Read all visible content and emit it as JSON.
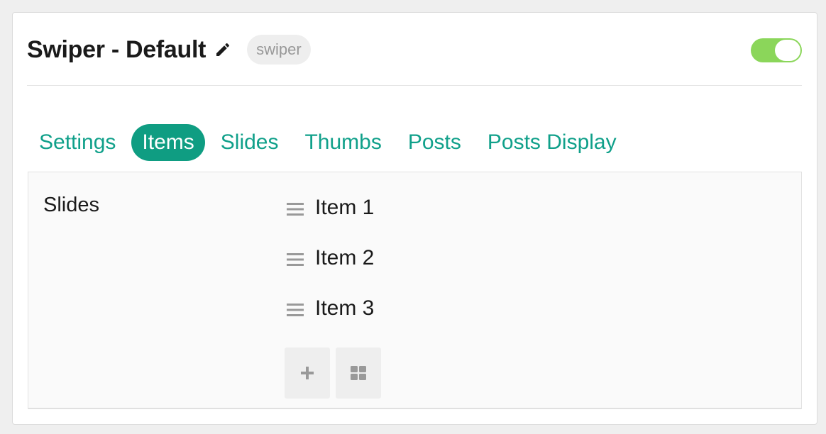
{
  "header": {
    "title": "Swiper - Default",
    "badge": "swiper",
    "toggle_on": true
  },
  "tabs": [
    {
      "label": "Settings",
      "active": false
    },
    {
      "label": "Items",
      "active": true
    },
    {
      "label": "Slides",
      "active": false
    },
    {
      "label": "Thumbs",
      "active": false
    },
    {
      "label": "Posts",
      "active": false
    },
    {
      "label": "Posts Display",
      "active": false
    }
  ],
  "panel": {
    "field_label": "Slides",
    "items": [
      {
        "label": "Item 1"
      },
      {
        "label": "Item 2"
      },
      {
        "label": "Item 3"
      }
    ]
  },
  "icons": {
    "edit": "pencil-icon",
    "drag": "drag-handle-icon",
    "add": "plus-icon",
    "grid": "grid-icon"
  },
  "colors": {
    "accent": "#0f9d82",
    "tab_text": "#10a08a",
    "toggle_on": "#8bd65a",
    "icon_gray": "#999999"
  }
}
